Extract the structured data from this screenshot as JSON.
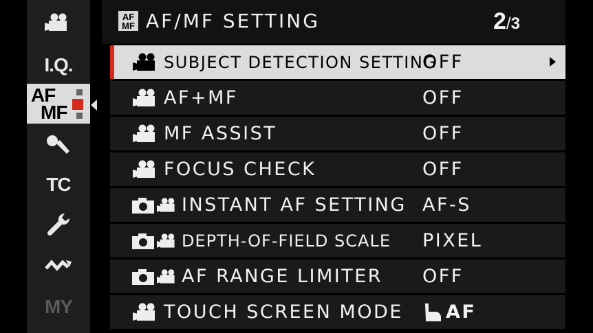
{
  "sidebar": {
    "items": [
      {
        "name": "movie-icon"
      },
      {
        "label": "I.Q."
      },
      {
        "label_line1": "AF",
        "label_line2": "MF"
      },
      {
        "name": "microphone-icon"
      },
      {
        "label": "TC"
      },
      {
        "name": "wrench-icon"
      },
      {
        "name": "connection-icon"
      },
      {
        "label": "MY"
      }
    ]
  },
  "header": {
    "icon_line1": "AF",
    "icon_line2": "MF",
    "title": "AF/MF SETTING",
    "page_current": "2",
    "page_separator": "/",
    "page_total": "3"
  },
  "menu": {
    "rows": [
      {
        "label": "SUBJECT DETECTION SETTING",
        "value": "OFF",
        "icons": [
          "movie-icon"
        ]
      },
      {
        "label": "AF+MF",
        "value": "OFF",
        "icons": [
          "movie-icon"
        ]
      },
      {
        "label": "MF ASSIST",
        "value": "OFF",
        "icons": [
          "movie-icon"
        ]
      },
      {
        "label": "FOCUS CHECK",
        "value": "OFF",
        "icons": [
          "movie-icon"
        ]
      },
      {
        "label": "INSTANT AF SETTING",
        "value": "AF-S",
        "icons": [
          "camera-icon",
          "movie-icon"
        ]
      },
      {
        "label": "DEPTH-OF-FIELD SCALE",
        "value": "PIXEL",
        "icons": [
          "camera-icon",
          "movie-icon"
        ]
      },
      {
        "label": "AF RANGE LIMITER",
        "value": "OFF",
        "icons": [
          "camera-icon",
          "movie-icon"
        ]
      },
      {
        "label": "TOUCH SCREEN MODE",
        "value": "AF",
        "icons": [
          "movie-icon"
        ],
        "value_icon": "touch-hand-icon"
      }
    ]
  },
  "colors": {
    "accent": "#d42b1c",
    "selected_row": "#dcdcdc",
    "row_bg": "#1a1a1a",
    "sidebar_bg": "#1e1e1e"
  }
}
